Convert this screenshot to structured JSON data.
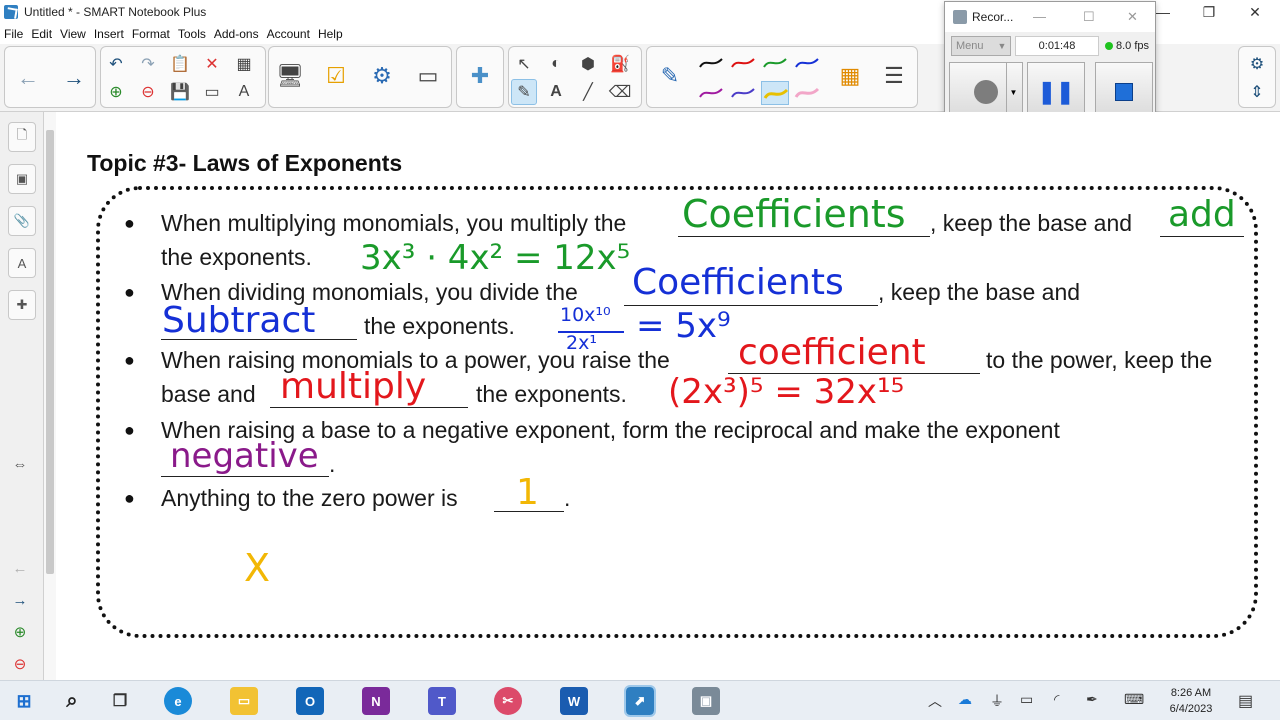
{
  "window": {
    "title": "Untitled * - SMART Notebook Plus",
    "controls": [
      "—",
      "❐",
      "✕"
    ]
  },
  "menu": [
    "File",
    "Edit",
    "View",
    "Insert",
    "Format",
    "Tools",
    "Add-ons",
    "Account",
    "Help"
  ],
  "recorder": {
    "title": "Recor...",
    "menu_label": "Menu",
    "elapsed": "0:01:48",
    "fps": "8.0 fps"
  },
  "page": {
    "topic_title": "Topic #3- Laws of Exponents",
    "bullets": [
      {
        "lines": [
          [
            "When multiplying monomials, you multiply the",
            ", keep the base and"
          ],
          [
            "the exponents."
          ]
        ],
        "handwriting": [
          "Coefficients",
          "add",
          "3x³ · 4x² = 12x⁵"
        ]
      },
      {
        "lines": [
          [
            "When dividing monomials, you divide the",
            ", keep the base and"
          ],
          [
            "the exponents."
          ]
        ],
        "handwriting": [
          "Coefficients",
          "Subtract",
          "10x¹⁰",
          "2x¹",
          "= 5x⁹"
        ]
      },
      {
        "lines": [
          [
            "When raising monomials to a power, you raise the",
            "to the power, keep the"
          ],
          [
            "base and",
            "the exponents."
          ]
        ],
        "handwriting": [
          "coefficient",
          "multiply",
          "(2x³)⁵ = 32x¹⁵"
        ]
      },
      {
        "lines": [
          [
            "When raising a base to a negative exponent, form the reciprocal and make the exponent"
          ],
          [
            "."
          ]
        ],
        "handwriting": [
          "negative"
        ]
      },
      {
        "lines": [
          [
            "Anything to the zero power is",
            "."
          ]
        ],
        "handwriting": [
          "1"
        ]
      }
    ],
    "stray_mark": "X"
  },
  "colors": {
    "ink_green": "#1a9a2a",
    "ink_blue": "#1530d6",
    "ink_red": "#e3171c",
    "ink_purple": "#8a1a8a",
    "ink_yellow": "#f2b705"
  },
  "taskbar": {
    "apps": [
      "start-icon",
      "search-icon",
      "task-view-icon",
      "edge-icon",
      "file-explorer-icon",
      "outlook-icon",
      "onenote-icon",
      "teams-icon",
      "snipping-icon",
      "word-icon",
      "smart-notebook-icon",
      "recorder-icon"
    ],
    "time": "8:26 AM",
    "date": "6/4/2023"
  }
}
